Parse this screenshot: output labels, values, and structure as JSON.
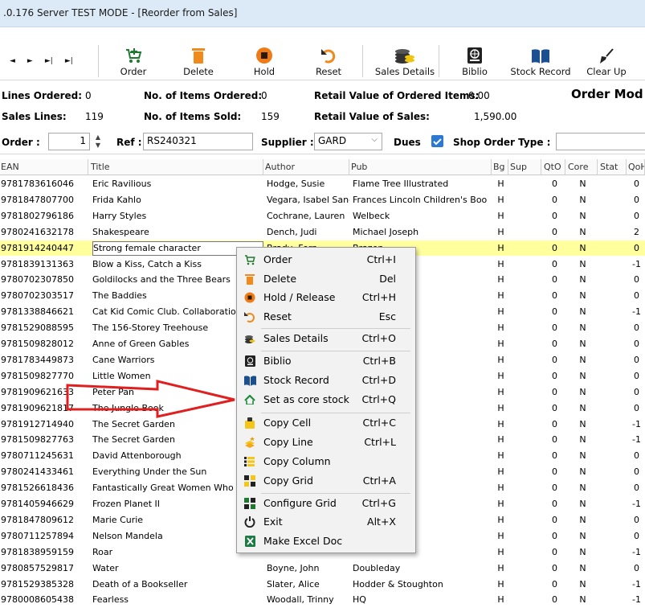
{
  "window": {
    "title": ".0.176 Server TEST MODE - [Reorder from Sales]"
  },
  "toolbar": {
    "nav": [
      "◄",
      "►",
      "►|",
      "►|"
    ],
    "buttons": [
      {
        "label": "Order",
        "icon": "cart-plus-icon"
      },
      {
        "label": "Delete",
        "icon": "trash-icon"
      },
      {
        "label": "Hold",
        "icon": "hold-icon"
      },
      {
        "label": "Reset",
        "icon": "undo-icon"
      },
      {
        "label": "Sales Details",
        "icon": "coins-icon"
      },
      {
        "label": "Biblio",
        "icon": "globe-book-icon"
      },
      {
        "label": "Stock Record",
        "icon": "open-book-icon"
      },
      {
        "label": "Clear Up",
        "icon": "broom-icon"
      }
    ]
  },
  "stats": {
    "lines_ordered_label": "Lines Ordered:",
    "lines_ordered": "0",
    "items_ordered_label": "No. of Items Ordered:",
    "items_ordered": "0",
    "retail_ordered_label": "Retail Value of Ordered Items:",
    "retail_ordered": "0.00",
    "order_mode_label": "Order Mod",
    "sales_lines_label": "Sales Lines:",
    "sales_lines": "119",
    "items_sold_label": "No. of Items Sold:",
    "items_sold": "159",
    "retail_sales_label": "Retail Value of Sales:",
    "retail_sales": "1,590.00"
  },
  "filter": {
    "order_label": "Order :",
    "order_value": "1",
    "ref_label": "Ref :",
    "ref_value": "RS240321",
    "supplier_label": "Supplier :",
    "supplier_value": "GARD",
    "dues_label": "Dues",
    "shop_order_type_label": "Shop Order Type :"
  },
  "grid": {
    "columns": [
      "EAN",
      "Title",
      "Author",
      "Pub",
      "Bg",
      "Sup",
      "QtO",
      "Core",
      "Stat",
      "QoH"
    ],
    "rows": [
      [
        "9781783616046",
        "Eric Ravilious",
        "Hodge, Susie",
        "Flame Tree Illustrated",
        "H",
        "",
        "0",
        "N",
        "",
        "0"
      ],
      [
        "9781847807700",
        "Frida Kahlo",
        "Vegara, Isabel Sanc",
        "Frances Lincoln Children's Boo",
        "H",
        "",
        "0",
        "N",
        "",
        "0"
      ],
      [
        "9781802796186",
        "Harry Styles",
        "Cochrane, Lauren",
        "Welbeck",
        "H",
        "",
        "0",
        "N",
        "",
        "0"
      ],
      [
        "9780241632178",
        "Shakespeare",
        "Dench, Judi",
        "Michael Joseph",
        "H",
        "",
        "0",
        "N",
        "",
        "2"
      ],
      [
        "9781914240447",
        "Strong female character",
        "Brady, Fern",
        "Brazen",
        "H",
        "",
        "0",
        "N",
        "",
        "0"
      ],
      [
        "9781839131363",
        "Blow a Kiss, Catch a Kiss",
        "",
        "s",
        "H",
        "",
        "0",
        "N",
        "",
        "-1"
      ],
      [
        "9780702307850",
        "Goldilocks and the Three Bears",
        "",
        "ooks",
        "H",
        "",
        "0",
        "N",
        "",
        "0"
      ],
      [
        "9780702303517",
        "The Baddies",
        "",
        "ooks",
        "H",
        "",
        "0",
        "N",
        "",
        "0"
      ],
      [
        "9781338846621",
        "Cat Kid Comic Club. Collaborations",
        "",
        "",
        "H",
        "",
        "0",
        "N",
        "",
        "-1"
      ],
      [
        "9781529088595",
        "The 156-Storey Treehouse",
        "",
        "dren's Books",
        "H",
        "",
        "0",
        "N",
        "",
        "0"
      ],
      [
        "9781509828012",
        "Anne of Green Gables",
        "",
        "ector's Library",
        "H",
        "",
        "0",
        "N",
        "",
        "0"
      ],
      [
        "9781783449873",
        "Cane Warriors",
        "",
        "",
        "H",
        "",
        "0",
        "N",
        "",
        "0"
      ],
      [
        "9781509827770",
        "Little Women",
        "",
        "ector's Library",
        "H",
        "",
        "0",
        "N",
        "",
        "0"
      ],
      [
        "9781909621633",
        "Peter Pan",
        "",
        "ector's Library",
        "H",
        "",
        "0",
        "N",
        "",
        "0"
      ],
      [
        "9781909621817",
        "The Jungle Book",
        "",
        "ector's Library",
        "H",
        "",
        "0",
        "N",
        "",
        "0"
      ],
      [
        "9781912714940",
        "The Secret Garden",
        "",
        "ing",
        "H",
        "",
        "0",
        "N",
        "",
        "-1"
      ],
      [
        "9781509827763",
        "The Secret Garden",
        "",
        "ector's Library",
        "H",
        "",
        "0",
        "N",
        "",
        "-1"
      ],
      [
        "9780711245631",
        "David Attenborough",
        "",
        "Children's Boo",
        "H",
        "",
        "0",
        "N",
        "",
        "0"
      ],
      [
        "9780241433461",
        "Everything Under the Sun",
        "",
        "",
        "H",
        "",
        "0",
        "N",
        "",
        "0"
      ],
      [
        "9781526618436",
        "Fantastically Great Women Who Sa",
        "",
        "ldren's Books",
        "H",
        "",
        "0",
        "N",
        "",
        "0"
      ],
      [
        "9781405946629",
        "Frozen Planet II",
        "",
        "Books",
        "H",
        "",
        "0",
        "N",
        "",
        "-1"
      ],
      [
        "9781847809612",
        "Marie Curie",
        "",
        "Children's Boo",
        "H",
        "",
        "0",
        "N",
        "",
        "0"
      ],
      [
        "9780711257894",
        "Nelson Mandela",
        "",
        "Children's Boo",
        "H",
        "",
        "0",
        "N",
        "",
        "0"
      ],
      [
        "9781838959159",
        "Roar",
        "",
        "",
        "H",
        "",
        "0",
        "N",
        "",
        "-1"
      ],
      [
        "9780857529817",
        "Water",
        "Boyne, John",
        "Doubleday",
        "H",
        "",
        "0",
        "N",
        "",
        "0"
      ],
      [
        "9781529385328",
        "Death of a Bookseller",
        "Slater, Alice",
        "Hodder & Stoughton",
        "H",
        "",
        "0",
        "N",
        "",
        "-1"
      ],
      [
        "9780008605438",
        "Fearless",
        "Woodall, Trinny",
        "HQ",
        "H",
        "",
        "0",
        "N",
        "",
        "-1"
      ]
    ]
  },
  "context_menu": {
    "items": [
      {
        "label": "Order",
        "shortcut": "Ctrl+I",
        "icon": "cart-plus-icon"
      },
      {
        "label": "Delete",
        "shortcut": "Del",
        "icon": "trash-icon"
      },
      {
        "label": "Hold / Release",
        "shortcut": "Ctrl+H",
        "icon": "hold-icon"
      },
      {
        "label": "Reset",
        "shortcut": "Esc",
        "icon": "undo-icon"
      },
      {
        "label": "Sales Details",
        "shortcut": "Ctrl+O",
        "icon": "coins-icon"
      },
      {
        "label": "Biblio",
        "shortcut": "Ctrl+B",
        "icon": "globe-book-icon"
      },
      {
        "label": "Stock Record",
        "shortcut": "Ctrl+D",
        "icon": "open-book-icon"
      },
      {
        "label": "Set as core stock",
        "shortcut": "Ctrl+Q",
        "icon": "house-icon"
      },
      {
        "label": "Copy Cell",
        "shortcut": "Ctrl+C",
        "icon": "copy-cell-icon"
      },
      {
        "label": "Copy Line",
        "shortcut": "Ctrl+L",
        "icon": "copy-line-icon"
      },
      {
        "label": "Copy Column",
        "shortcut": "",
        "icon": "copy-column-icon"
      },
      {
        "label": "Copy Grid",
        "shortcut": "Ctrl+A",
        "icon": "copy-grid-icon"
      },
      {
        "label": "Configure Grid",
        "shortcut": "Ctrl+G",
        "icon": "configure-grid-icon"
      },
      {
        "label": "Exit",
        "shortcut": "Alt+X",
        "icon": "power-icon"
      },
      {
        "label": "Make Excel Doc",
        "shortcut": "",
        "icon": "excel-icon"
      }
    ]
  },
  "colors": {
    "selected_row": "#ffff9e",
    "annotation_arrow": "#e02020",
    "accent": "#2b79d0"
  }
}
